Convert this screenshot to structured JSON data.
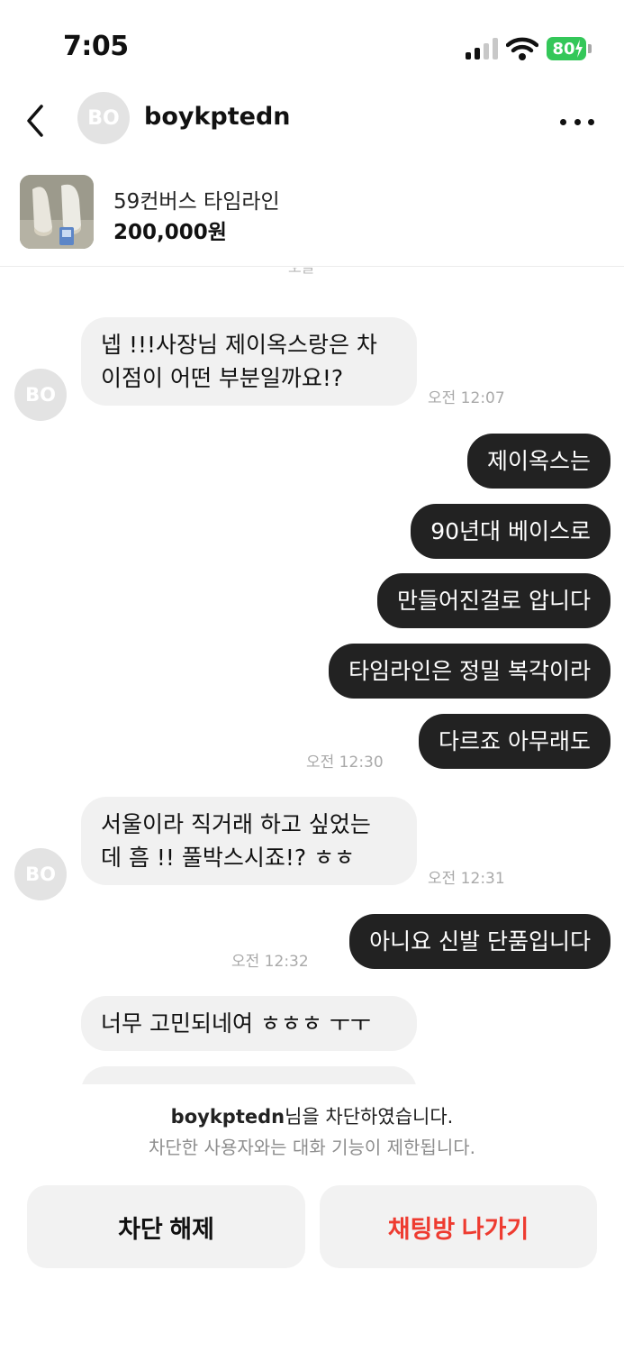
{
  "status": {
    "time": "7:05",
    "battery": "80"
  },
  "header": {
    "avatar_initials": "BO",
    "username": "boykptedn"
  },
  "product": {
    "title": "59컨버스 타임라인",
    "price": "200,000원"
  },
  "chat": {
    "date_label": "오늘",
    "messages": [
      {
        "side": "in",
        "lines": [
          "넵 !!!사장님 제이옥스랑은 차",
          "이점이 어떤 부분일까요!?"
        ],
        "time": "오전 12:07"
      },
      {
        "side": "out",
        "text": "제이옥스는"
      },
      {
        "side": "out",
        "text": "90년대 베이스로"
      },
      {
        "side": "out",
        "text": "만들어진걸로 압니다"
      },
      {
        "side": "out",
        "text": "타임라인은 정밀 복각이라"
      },
      {
        "side": "out",
        "text": "다르죠 아무래도",
        "time": "오전 12:30"
      },
      {
        "side": "in",
        "lines": [
          "서울이라 직거래 하고 싶었는",
          "데 흠 !! 풀박스시죠!? ㅎㅎ"
        ],
        "time": "오전 12:31"
      },
      {
        "side": "out",
        "text": "아니요 신발 단품입니다",
        "time": "오전 12:32"
      },
      {
        "side": "in",
        "text": "너무 고민되네여 ㅎㅎㅎ ㅜㅜ"
      }
    ]
  },
  "blocked": {
    "username": "boykptedn",
    "title_suffix": "님을 차단하였습니다.",
    "description": "차단한 사용자와는 대화 기능이 제한됩니다.",
    "unblock_label": "차단 해제",
    "leave_label": "채팅방 나가기",
    "leave_color": "#ee3b30"
  },
  "colors": {
    "outgoing_bubble": "#222222",
    "incoming_bubble": "#f1f1f1",
    "battery": "#34c759"
  }
}
